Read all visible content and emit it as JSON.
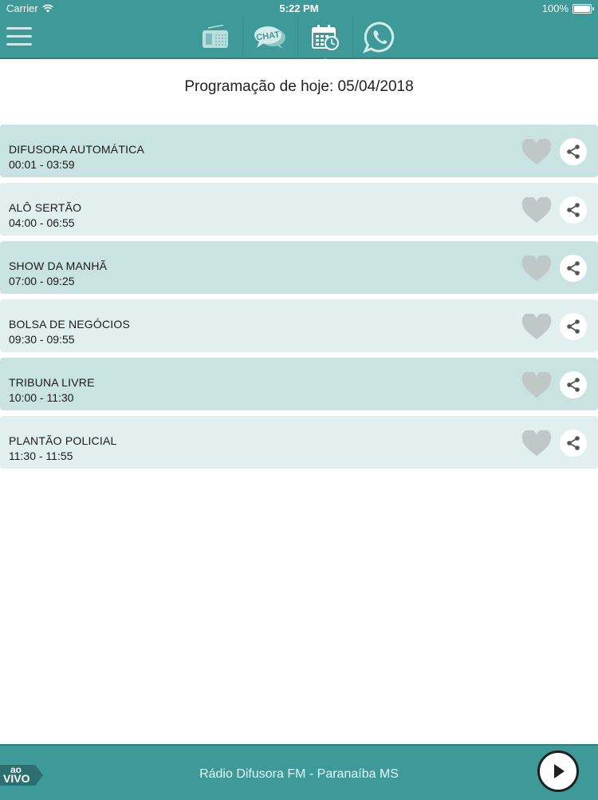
{
  "status_bar": {
    "carrier": "Carrier",
    "time": "5:22 PM",
    "battery": "100%",
    "battery_level": 1.0
  },
  "nav": {
    "menu_icon": "hamburger-menu-icon",
    "tabs": [
      {
        "icon": "radio-icon",
        "active": false
      },
      {
        "icon": "chat-icon",
        "label": "CHAT",
        "active": false
      },
      {
        "icon": "calendar-clock-icon",
        "active": true
      },
      {
        "icon": "whatsapp-icon",
        "active": false
      }
    ]
  },
  "page": {
    "title": "Programação de hoje: 05/04/2018"
  },
  "programs": [
    {
      "name": "DIFUSORA AUTOMÁTICA",
      "time": "00:01 - 03:59"
    },
    {
      "name": "ALÔ SERTÃO",
      "time": "04:00 - 06:55"
    },
    {
      "name": "SHOW DA MANHÃ",
      "time": "07:00 - 09:25"
    },
    {
      "name": "BOLSA DE NEGÓCIOS",
      "time": "09:30 - 09:55"
    },
    {
      "name": "TRIBUNA LIVRE",
      "time": "10:00 - 11:30"
    },
    {
      "name": "PLANTÃO POLICIAL",
      "time": "11:30 - 11:55"
    }
  ],
  "player": {
    "live_line1": "ao",
    "live_line2": "VIVO",
    "station": "Rádio Difusora FM - Paranaíba MS",
    "play_icon": "play-icon"
  },
  "colors": {
    "primary": "#3d9a98",
    "row_dark": "#c8e3e2",
    "row_light": "#e1f0ef",
    "icon_gray": "#bfc7c7"
  }
}
